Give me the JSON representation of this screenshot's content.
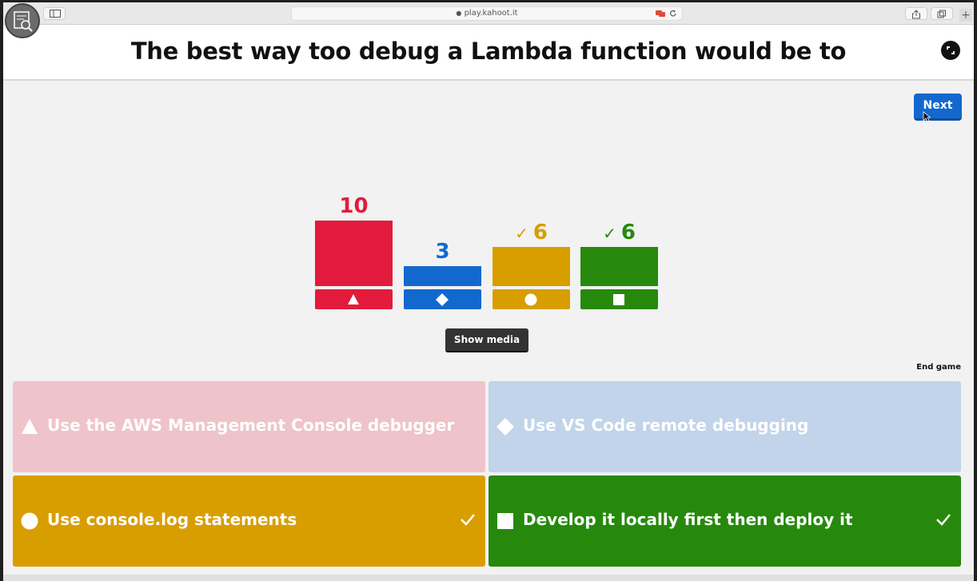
{
  "browser": {
    "url": "play.kahoot.it"
  },
  "question": {
    "title": "The best way too debug a Lambda function would be to"
  },
  "controls": {
    "next_label": "Next",
    "show_media_label": "Show media",
    "end_game_label": "End game"
  },
  "results": [
    {
      "count": "10",
      "correct": false,
      "shape": "triangle",
      "color": "#e21b3c"
    },
    {
      "count": "3",
      "correct": false,
      "shape": "diamond",
      "color": "#1368ce"
    },
    {
      "count": "6",
      "correct": true,
      "shape": "circle",
      "color": "#d89e00"
    },
    {
      "count": "6",
      "correct": true,
      "shape": "square",
      "color": "#26890c"
    }
  ],
  "answers": [
    {
      "text": "Use the AWS Management Console debugger",
      "shape": "triangle",
      "correct": false,
      "color": "#e21b3c"
    },
    {
      "text": "Use VS Code remote debugging",
      "shape": "diamond",
      "correct": false,
      "color": "#1368ce"
    },
    {
      "text": "Use console.log statements",
      "shape": "circle",
      "correct": true,
      "color": "#d89e00"
    },
    {
      "text": "Develop it locally first then deploy it",
      "shape": "square",
      "correct": true,
      "color": "#26890c"
    }
  ],
  "check_mark": "✓"
}
